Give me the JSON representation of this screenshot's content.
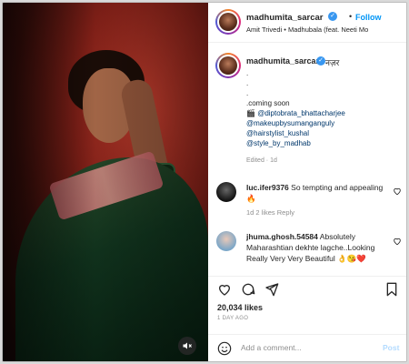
{
  "header": {
    "username": "madhumita_sarcar",
    "separator": "•",
    "follow_label": "Follow",
    "song": "Amit Trivedi • Madhubala (feat. Neeti Mo"
  },
  "caption": {
    "username": "madhumita_sarcar",
    "title": "नज़र",
    "lines": [
      ".",
      ".",
      ".",
      ".coming soon"
    ],
    "credit_emoji": "🎬",
    "mentions": [
      "@diptobrata_bhattacharjee",
      "@makeupbysumanganguly",
      "@hairstylist_kushal",
      "@style_by_madhab"
    ],
    "meta": "Edited · 1d"
  },
  "comments": [
    {
      "username": "luc.ifer9376",
      "text": "So tempting and appealing 🔥",
      "meta": "1d   2 likes   Reply"
    },
    {
      "username": "jhuma.ghosh.54584",
      "text": "Absolutely Maharashtian dekhte lagche..Looking Really Very Very Beautiful 👌😘❤️",
      "meta": ""
    }
  ],
  "engagement": {
    "likes": "20,034 likes",
    "date": "1 DAY AGO"
  },
  "composer": {
    "placeholder": "Add a comment...",
    "post_label": "Post"
  },
  "icons": {
    "verified": "verified-badge-icon",
    "heart": "heart-icon",
    "comment": "comment-icon",
    "share": "share-icon",
    "save": "bookmark-icon",
    "emoji": "emoji-icon",
    "mute": "speaker-muted-icon"
  },
  "colors": {
    "link": "#0095f6",
    "mention": "#00376b",
    "muted_text": "#8e8e8e"
  }
}
